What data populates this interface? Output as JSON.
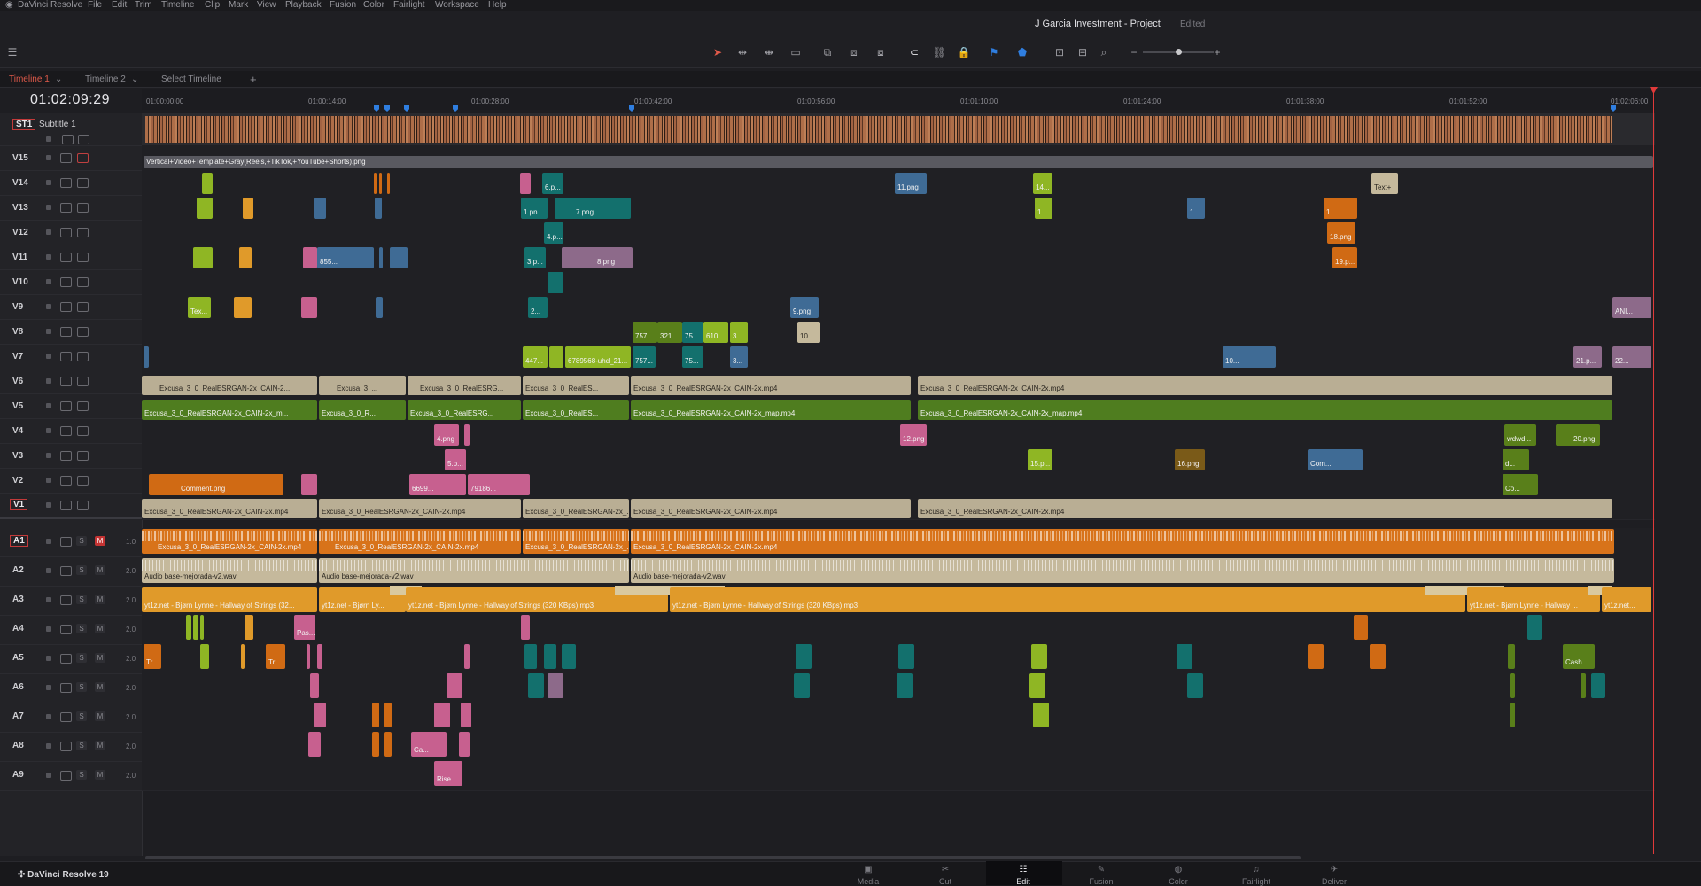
{
  "app": {
    "name": "DaVinci Resolve",
    "menu": [
      "File",
      "Edit",
      "Trim",
      "Timeline",
      "Clip",
      "Mark",
      "View",
      "Playback",
      "Fusion",
      "Color",
      "Fairlight",
      "Workspace",
      "Help"
    ],
    "project_title": "J Garcia Investment - Project",
    "project_status": "Edited"
  },
  "tabs": [
    "Timeline 1",
    "Timeline 2",
    "Select Timeline"
  ],
  "timecode": "01:02:09:29",
  "ruler": [
    "01:00:00:00",
    "01:00:14:00",
    "01:00:28:00",
    "01:00:42:00",
    "01:00:56:00",
    "01:01:10:00",
    "01:01:24:00",
    "01:01:38:00",
    "01:01:52:00",
    "01:02:06:00"
  ],
  "subtitle_track": {
    "id": "ST1",
    "name": "Subtitle 1"
  },
  "video_tracks": [
    "V15",
    "V14",
    "V13",
    "V12",
    "V11",
    "V10",
    "V9",
    "V8",
    "V7",
    "V6",
    "V5",
    "V4",
    "V3",
    "V2",
    "V1"
  ],
  "audio_tracks": [
    {
      "name": "A1",
      "vol": "1.0"
    },
    {
      "name": "A2",
      "vol": "2.0"
    },
    {
      "name": "A3",
      "vol": "2.0"
    },
    {
      "name": "A4",
      "vol": "2.0"
    },
    {
      "name": "A5",
      "vol": "2.0"
    },
    {
      "name": "A6",
      "vol": "2.0"
    },
    {
      "name": "A7",
      "vol": "2.0"
    },
    {
      "name": "A8",
      "vol": "2.0"
    },
    {
      "name": "A9",
      "vol": "2.0"
    }
  ],
  "clips": {
    "v15_main": "Vertical+Video+Template+Gray(Reels,+TikTok,+YouTube+Shorts).png",
    "v14_6p": "6.p...",
    "v14_11": "11.png",
    "v14_14": "14...",
    "v14_text": "Text+",
    "v13_1pn": "1.pn...",
    "v13_7": "7.png",
    "v13_1a": "1...",
    "v13_1b": "1...",
    "v13_1c": "1...",
    "v12_4p": "4.p...",
    "v12_18": "18.png",
    "v11_855": "855...",
    "v11_3p": "3.p...",
    "v11_8": "8.png",
    "v11_19p": "19.p...",
    "v9_tex": "Tex...",
    "v9_2": "2...",
    "v9_9": "9.png",
    "v9_ani": "ANI...",
    "v8_757": "757...",
    "v8_321": "321...",
    "v8_75": "75...",
    "v8_610": "610...",
    "v8_3": "3...",
    "v8_10": "10...",
    "v7_447": "447...",
    "v7_6789": "6789568-uhd_21...",
    "v7_757": "757...",
    "v7_75": "75...",
    "v7_3": "3...",
    "v7_10": "10...",
    "v7_21p": "21.p...",
    "v7_22": "22...",
    "v6_a": "Excusa_3_0_RealESRGAN-2x_CAIN-2...",
    "v6_b": "Excusa_3_...",
    "v6_c": "Excusa_3_0_RealESRG...",
    "v6_d": "Excusa_3_0_RealES...",
    "v6_e": "Excusa_3_0_RealESRGAN-2x_CAIN-2x.mp4",
    "v6_f": "Excusa_3_0_RealESRGAN-2x_CAIN-2x.mp4",
    "v5_a": "Excusa_3_0_RealESRGAN-2x_CAIN-2x_m...",
    "v5_b": "Excusa_3_0_R...",
    "v5_c": "Excusa_3_0_RealESRG...",
    "v5_d": "Excusa_3_0_RealES...",
    "v5_e": "Excusa_3_0_RealESRGAN-2x_CAIN-2x_map.mp4",
    "v5_f": "Excusa_3_0_RealESRGAN-2x_CAIN-2x_map.mp4",
    "v4_4": "4.png",
    "v4_12": "12.png",
    "v4_wdwd": "wdwd...",
    "v4_20": "20.png",
    "v3_5p": "5.p...",
    "v3_15p": "15.p...",
    "v3_16": "16.png",
    "v3_com": "Com...",
    "v3_d": "d...",
    "v2_comment": "Comment.png",
    "v2_6699": "6699...",
    "v2_79186": "79186...",
    "v2_co": "Co...",
    "v1_a": "Excusa_3_0_RealESRGAN-2x_CAIN-2x.mp4",
    "v1_b": "Excusa_3_0_RealESRGAN-2x_CAIN-2x.mp4",
    "v1_c": "Excusa_3_0_RealESRGAN-2x_...",
    "v1_d": "Excusa_3_0_RealESRGAN-2x_CAIN-2x.mp4",
    "v1_e": "Excusa_3_0_RealESRGAN-2x_CAIN-2x.mp4",
    "a1_a": "Excusa_3_0_RealESRGAN-2x_CAIN-2x.mp4",
    "a1_b": "Excusa_3_0_RealESRGAN-2x_CAIN-2x.mp4",
    "a1_c": "Excusa_3_0_RealESRGAN-2x_...",
    "a1_d": "Excusa_3_0_RealESRGAN-2x_CAIN-2x.mp4",
    "a2_a": "Audio base-mejorada-v2.wav",
    "a2_b": "Audio base-mejorada-v2.wav",
    "a2_c": "Audio base-mejorada-v2.wav",
    "a3_a": "yt1z.net - Bjørn Lynne - Hallway of Strings (32...",
    "a3_b": "yt1z.net - Bjørn Ly...",
    "a3_c": "yt1z.net - Bjørn Lynne - Hallway of Strings (320 KBps).mp3",
    "a3_d": "yt1z.net - Bjørn Lynne - Hallway of Strings (320 KBps).mp3",
    "a3_e": "yt1z.net - Bjørn Lynne - Hallway ...",
    "a3_f": "yt1z.net...",
    "a4_pas": "Pas...",
    "a5_tr1": "Tr...",
    "a5_tr2": "Tr...",
    "a5_cash": "Cash ...",
    "a8_ca": "Ca...",
    "a9_rise": "Rise..."
  },
  "pages": [
    "Media",
    "Cut",
    "Edit",
    "Fusion",
    "Color",
    "Fairlight",
    "Deliver"
  ],
  "active_page": "Edit",
  "brand": "DaVinci Resolve 19"
}
